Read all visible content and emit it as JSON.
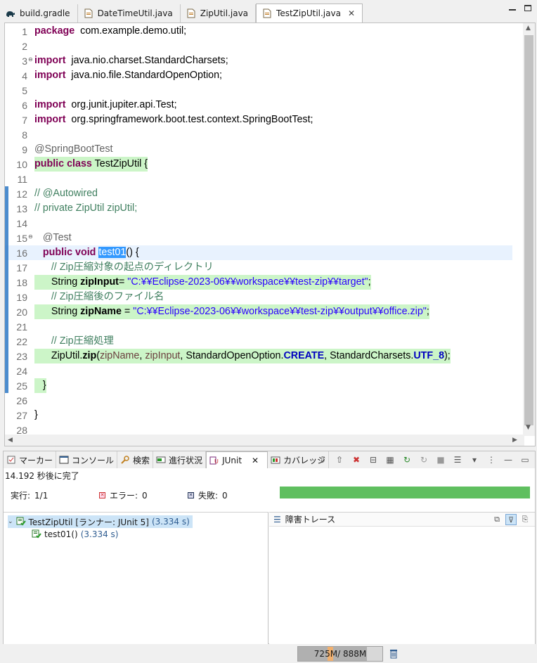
{
  "editor_tabs": [
    {
      "label": "build.gradle",
      "icon": "gradle-elephant-icon",
      "active": false
    },
    {
      "label": "DateTimeUtil.java",
      "icon": "java-file-icon",
      "active": false
    },
    {
      "label": "ZipUtil.java",
      "icon": "java-file-icon",
      "active": false
    },
    {
      "label": "TestZipUtil.java",
      "icon": "java-file-icon",
      "active": true,
      "close": "✕"
    }
  ],
  "code": {
    "lines": [
      {
        "n": "1",
        "segs": [
          [
            "kw",
            "package"
          ],
          [
            "",
            "  com.example.demo.util;"
          ]
        ]
      },
      {
        "n": "2",
        "segs": []
      },
      {
        "n": "3",
        "segs": [
          [
            "kw",
            "import"
          ],
          [
            "",
            "  java.nio.charset.StandardCharsets;"
          ]
        ],
        "fold": "⊖"
      },
      {
        "n": "4",
        "segs": [
          [
            "kw",
            "import"
          ],
          [
            "",
            "  java.nio.file.StandardOpenOption;"
          ]
        ]
      },
      {
        "n": "5",
        "segs": []
      },
      {
        "n": "6",
        "segs": [
          [
            "kw",
            "import"
          ],
          [
            "",
            "  org.junit.jupiter.api.Test;"
          ]
        ]
      },
      {
        "n": "7",
        "segs": [
          [
            "kw",
            "import"
          ],
          [
            "",
            "  org.springframework.boot.test.context.SpringBootTest;"
          ]
        ]
      },
      {
        "n": "8",
        "segs": []
      },
      {
        "n": "9",
        "segs": [
          [
            "ann",
            "@SpringBootTest"
          ]
        ]
      },
      {
        "n": "10",
        "segs": [
          [
            "kw",
            "public"
          ],
          [
            "",
            " "
          ],
          [
            "kw",
            "class"
          ],
          [
            "",
            " TestZipUtil {"
          ]
        ],
        "hl": "green-text"
      },
      {
        "n": "11",
        "segs": []
      },
      {
        "n": "12",
        "segs": [
          [
            "cm",
            "// @Autowired"
          ]
        ]
      },
      {
        "n": "13",
        "segs": [
          [
            "cm",
            "// private ZipUtil zipUtil;"
          ]
        ]
      },
      {
        "n": "14",
        "segs": []
      },
      {
        "n": "15",
        "segs": [
          [
            "ann",
            "   @Test"
          ]
        ],
        "fold": "⊖"
      },
      {
        "n": "16",
        "segs": [
          [
            "",
            "   "
          ],
          [
            "kw",
            "public"
          ],
          [
            "",
            " "
          ],
          [
            "kw",
            "void"
          ],
          [
            "",
            " "
          ],
          [
            "sel",
            "test01"
          ],
          [
            "",
            "() {"
          ]
        ],
        "hl": "cur"
      },
      {
        "n": "17",
        "segs": [
          [
            "cm",
            "      // Zip圧縮対象の起点のディレクトリ"
          ]
        ]
      },
      {
        "n": "18",
        "segs": [
          [
            "",
            "      String "
          ],
          [
            "bold",
            "zipInput"
          ],
          [
            "",
            "= "
          ],
          [
            "str",
            "\"C:¥¥Eclipse-2023-06¥¥workspace¥¥test-zip¥¥target\""
          ],
          [
            "",
            ";"
          ]
        ],
        "hl": "green"
      },
      {
        "n": "19",
        "segs": [
          [
            "cm",
            "      // Zip圧縮後のファイル名"
          ]
        ]
      },
      {
        "n": "20",
        "segs": [
          [
            "",
            "      String "
          ],
          [
            "bold",
            "zipName"
          ],
          [
            "",
            " = "
          ],
          [
            "str",
            "\"C:¥¥Eclipse-2023-06¥¥workspace¥¥test-zip¥¥output¥¥office.zip\""
          ],
          [
            "",
            ";"
          ]
        ],
        "hl": "green"
      },
      {
        "n": "21",
        "segs": []
      },
      {
        "n": "22",
        "segs": [
          [
            "cm",
            "      // Zip圧縮処理"
          ]
        ]
      },
      {
        "n": "23",
        "segs": [
          [
            "",
            "      ZipUtil."
          ],
          [
            "bold",
            "zip"
          ],
          [
            "",
            "("
          ],
          [
            "param",
            "zipName"
          ],
          [
            "",
            ", "
          ],
          [
            "param",
            "zipInput"
          ],
          [
            "",
            ", StandardOpenOption."
          ],
          [
            "fld",
            "CREATE"
          ],
          [
            "",
            ", StandardCharsets."
          ],
          [
            "fld",
            "UTF_8"
          ],
          [
            "",
            ");"
          ]
        ],
        "hl": "green"
      },
      {
        "n": "24",
        "segs": []
      },
      {
        "n": "25",
        "segs": [
          [
            "",
            "   }"
          ]
        ],
        "hl": "green-text"
      },
      {
        "n": "26",
        "segs": []
      },
      {
        "n": "27",
        "segs": [
          [
            "",
            "}"
          ]
        ]
      },
      {
        "n": "28",
        "segs": []
      }
    ]
  },
  "panel": {
    "tabs": [
      {
        "label": "マーカー",
        "icon": "marker-icon"
      },
      {
        "label": "コンソール",
        "icon": "console-icon"
      },
      {
        "label": "検索",
        "icon": "search-icon"
      },
      {
        "label": "進行状況",
        "icon": "progress-icon"
      },
      {
        "label": "JUnit",
        "icon": "junit-icon",
        "active": true,
        "close": "✕"
      },
      {
        "label": "カバレッジ",
        "icon": "coverage-icon"
      }
    ],
    "status": "14.192 秒後に完了",
    "runs_label": "実行:",
    "runs_value": "1/1",
    "errors_label": "エラー:",
    "errors_value": "0",
    "failures_label": "失敗:",
    "failures_value": "0",
    "progress_fraction": 1.0,
    "progress_color": "#5fbf5f",
    "tree": {
      "root_label": "TestZipUtil [ランナー: JUnit 5]",
      "root_time": "(3.334 s)",
      "child_label": "test01()",
      "child_time": "(3.334 s)"
    },
    "trace_title": "障害トレース"
  },
  "heap": {
    "used": "725M",
    "sep": "/",
    "total": "888M",
    "used_fraction": 0.816
  }
}
